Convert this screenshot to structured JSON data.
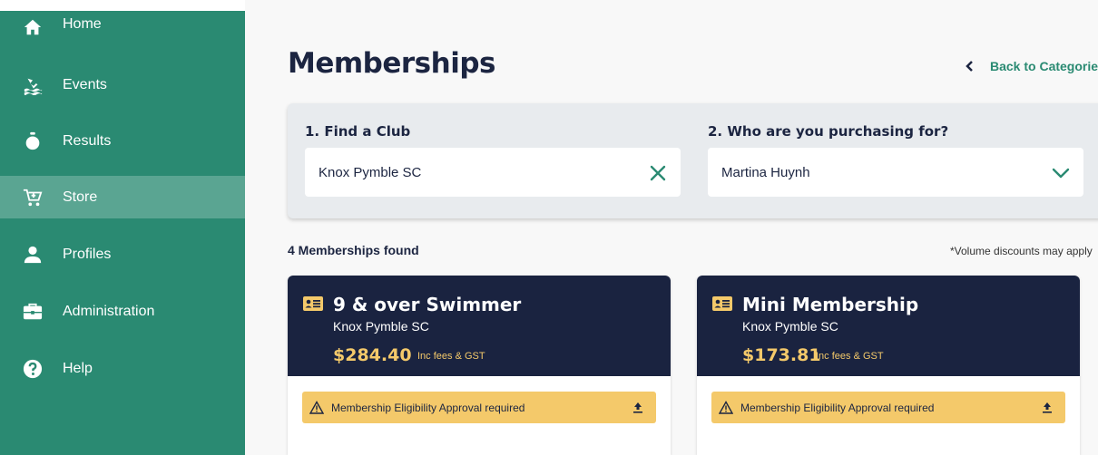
{
  "sidebar": {
    "items": [
      {
        "label": "Home",
        "icon": "home-icon"
      },
      {
        "label": "Events",
        "icon": "swimming-icon"
      },
      {
        "label": "Results",
        "icon": "stopwatch-icon"
      },
      {
        "label": "Store",
        "icon": "cart-icon",
        "active": true
      },
      {
        "label": "Profiles",
        "icon": "person-icon"
      },
      {
        "label": "Administration",
        "icon": "briefcase-icon"
      },
      {
        "label": "Help",
        "icon": "help-icon"
      }
    ]
  },
  "header": {
    "title": "Memberships",
    "back_label": "Back to Categories"
  },
  "search": {
    "club_label": "1. Find a Club",
    "club_value": "Knox Pymble SC",
    "for_label": "2. Who are you purchasing for?",
    "for_value": "Martina Huynh"
  },
  "results": {
    "count_text": "4 Memberships found",
    "note": "*Volume discounts may apply"
  },
  "cards": [
    {
      "title": "9 & over Swimmer",
      "club": "Knox Pymble SC",
      "price": "$284.40",
      "fees": "Inc fees & GST",
      "approval": "Membership Eligibility Approval required"
    },
    {
      "title": "Mini Membership",
      "club": "Knox Pymble SC",
      "price": "$173.81",
      "fees": "Inc fees & GST",
      "approval": "Membership Eligibility Approval required"
    }
  ],
  "colors": {
    "sidebar": "#2a8a72",
    "sidebar_active": "#5aa592",
    "navy": "#1a2340",
    "gold": "#f4c96a"
  }
}
